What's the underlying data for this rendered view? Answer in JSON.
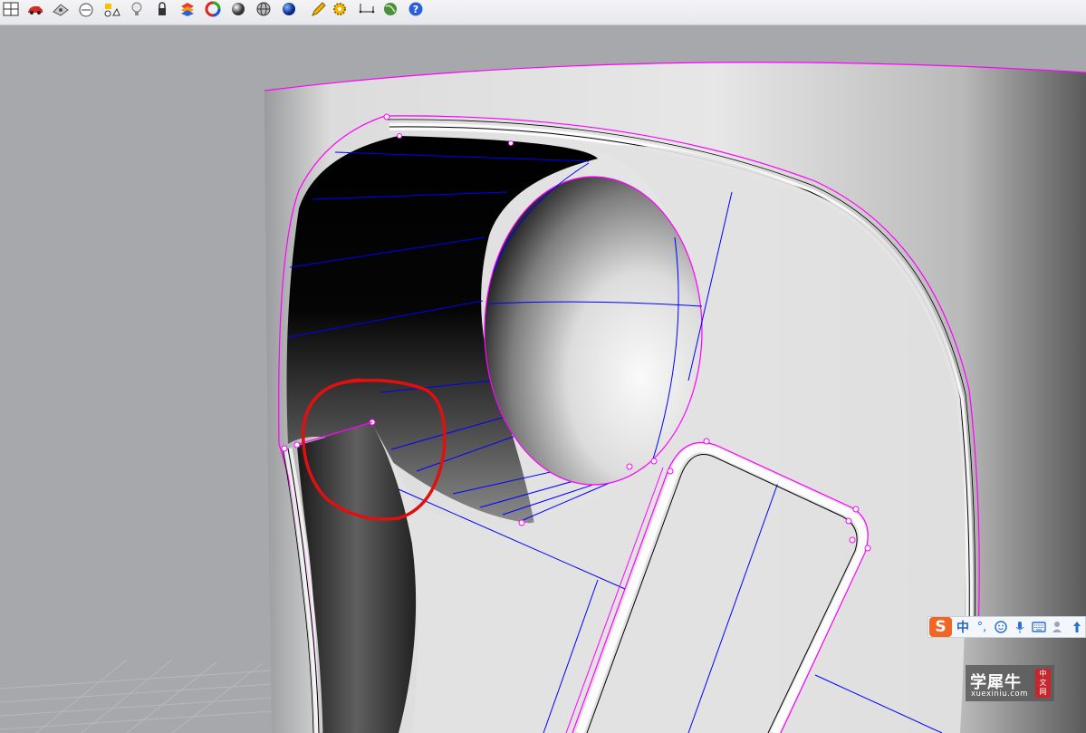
{
  "toolbar": {
    "icons": [
      "viewport-layout-icon",
      "car-icon",
      "eye-map-icon",
      "zebra-analysis-icon",
      "object-shapes-icon",
      "light-bulb-icon",
      "pen-lock-icon",
      "layer-stack-icon",
      "color-wheel-icon",
      "shaded-sphere-icon",
      "rendered-sphere-icon",
      "blue-sphere-icon",
      "pencil-icon",
      "gear-icon",
      "dimension-icon",
      "earth-globe-icon",
      "help-icon"
    ]
  },
  "viewport": {
    "background_color": "#a6a8ab",
    "curve_color": "#ff00ff",
    "isocurve_color": "#0000ff",
    "annotation_color": "#e01010"
  },
  "ime_bar": {
    "logo": "S",
    "language": "中",
    "punctuation": "°,",
    "icons": [
      "emoji-icon",
      "microphone-icon",
      "keyboard-icon",
      "user-icon",
      "upload-icon"
    ]
  },
  "watermark": {
    "title": "学犀牛",
    "url": "xuexiniu.com",
    "seal": [
      "中",
      "文",
      "网"
    ]
  }
}
